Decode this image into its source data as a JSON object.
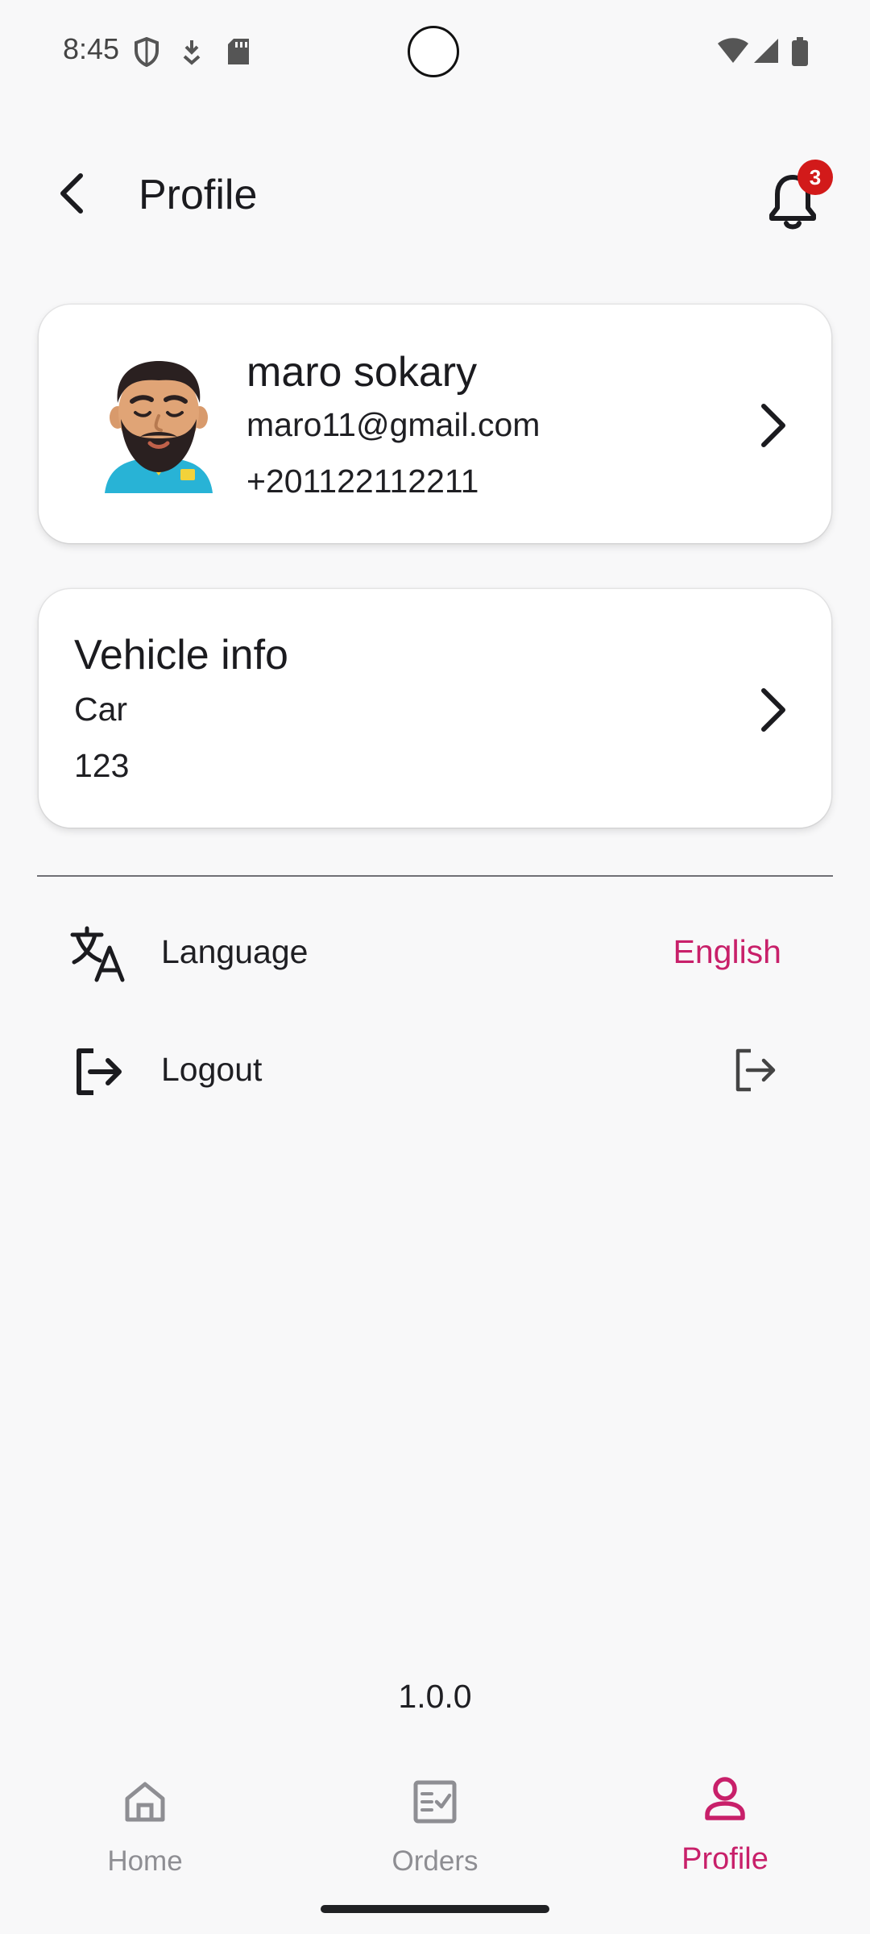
{
  "status_bar": {
    "time": "8:45"
  },
  "header": {
    "title": "Profile",
    "notification_count": "3"
  },
  "profile_card": {
    "name": "maro sokary",
    "email": "maro11@gmail.com",
    "phone": "+201122112211"
  },
  "vehicle_card": {
    "title": "Vehicle info",
    "type": "Car",
    "plate": "123"
  },
  "settings": {
    "language_label": "Language",
    "language_value": "English",
    "logout_label": "Logout"
  },
  "version": "1.0.0",
  "bottom_nav": {
    "items": [
      {
        "label": "Home",
        "icon": "home-icon",
        "active": false
      },
      {
        "label": "Orders",
        "icon": "orders-icon",
        "active": false
      },
      {
        "label": "Profile",
        "icon": "person-icon",
        "active": true
      }
    ]
  },
  "colors": {
    "accent": "#c8206a",
    "badge": "#d21a1a",
    "background": "#f8f8f9",
    "card": "#ffffff",
    "inactive": "#8e8e93"
  }
}
